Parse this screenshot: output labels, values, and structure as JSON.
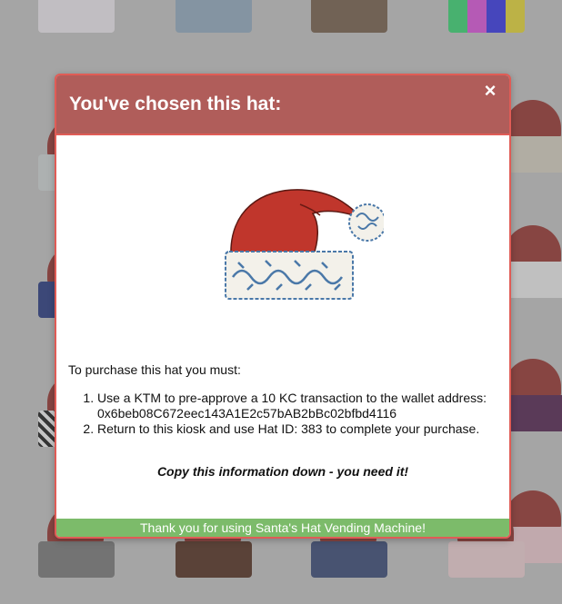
{
  "modal": {
    "title": "You've chosen this hat:",
    "close_icon": "×",
    "intro": "To purchase this hat you must:",
    "steps": [
      "Use a KTM to pre-approve a 10 KC transaction to the wallet address: 0x6beb08C672eec143A1E2c57bAB2bBc02bfbd4116",
      "Return to this kiosk and use Hat ID: 383 to complete your purchase."
    ],
    "warning": "Copy this information down - you need it!",
    "footer": "Thank you for using Santa's Hat Vending Machine!"
  },
  "colors": {
    "header_bg": "#b05d5a",
    "border": "#e05c56",
    "footer_bg": "#7cbb6a",
    "hat_red": "#c0362c",
    "pattern_blue": "#4a78a8"
  },
  "background_hats": [
    {
      "band": "marshmallow-pattern"
    },
    {
      "band": "blue-floral-pattern"
    },
    {
      "band": "cracked-earth-pattern"
    },
    {
      "band": "tv-color-bars-pattern"
    },
    {
      "band": "denim-pattern"
    },
    {
      "band": "coffee-beans-pattern"
    },
    {
      "band": "blue-fabric-pattern"
    },
    {
      "band": "pink-knit-pattern"
    },
    {
      "band": "houndstooth-pattern"
    }
  ]
}
